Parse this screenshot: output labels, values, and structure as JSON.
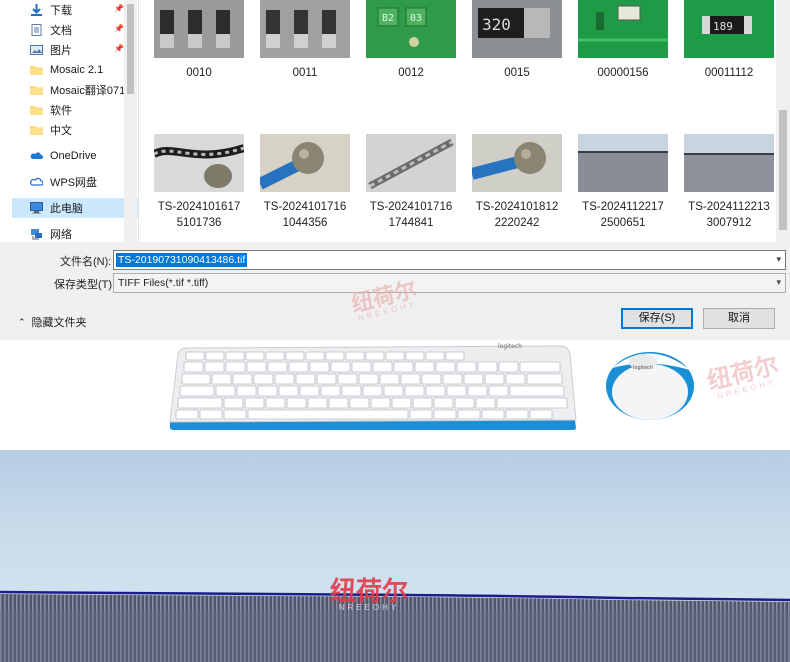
{
  "sidebar": {
    "items": [
      {
        "label": "下载",
        "icon": "download-arrow-icon",
        "pinned": true
      },
      {
        "label": "文档",
        "icon": "document-icon",
        "pinned": true
      },
      {
        "label": "图片",
        "icon": "pictures-icon",
        "pinned": true
      },
      {
        "label": "Mosaic 2.1",
        "icon": "folder-icon",
        "pinned": false
      },
      {
        "label": "Mosaic翻译071",
        "icon": "folder-icon",
        "pinned": false
      },
      {
        "label": "软件",
        "icon": "folder-icon",
        "pinned": false
      },
      {
        "label": "中文",
        "icon": "folder-icon",
        "pinned": false
      },
      {
        "label": "OneDrive",
        "icon": "onedrive-cloud-icon",
        "pinned": false
      },
      {
        "label": "WPS网盘",
        "icon": "wps-cloud-icon",
        "pinned": false
      },
      {
        "label": "此电脑",
        "icon": "this-pc-icon",
        "pinned": false,
        "selected": true
      },
      {
        "label": "网络",
        "icon": "network-icon",
        "pinned": false
      }
    ]
  },
  "files": {
    "row1": [
      {
        "name": "0010",
        "kind": "chip"
      },
      {
        "name": "0011",
        "kind": "chip"
      },
      {
        "name": "0012",
        "kind": "green-board"
      },
      {
        "name": "0015",
        "kind": "resistor-320"
      },
      {
        "name": "00000156",
        "kind": "green-board"
      },
      {
        "name": "00011112",
        "kind": "green-board-189"
      }
    ],
    "row2": [
      {
        "line1": "TS-20241016175",
        "line2": "101736",
        "name": "TS-2024101617",
        "name2": "5101736",
        "kind": "cable"
      },
      {
        "name": "TS-2024101716",
        "name2": "1044356",
        "kind": "ball-tip"
      },
      {
        "name": "TS-2024101716",
        "name2": "1744841",
        "kind": "drill"
      },
      {
        "name": "TS-2024101812",
        "name2": "2220242",
        "kind": "ball-tip"
      },
      {
        "name": "TS-2024112217",
        "name2": "2500651",
        "kind": "blade"
      },
      {
        "name": "TS-2024112213",
        "name2": "3007912",
        "kind": "blade"
      }
    ]
  },
  "thumb_text": {
    "b2": "B2",
    "t03": "03",
    "r320": "320",
    "r189": "189"
  },
  "form": {
    "filename_label": "文件名(N):",
    "filename_value": "TS-20190731090413486.tif",
    "filetype_label": "保存类型(T):",
    "filetype_value": "TIFF Files(*.tif *.tiff)",
    "hide_folders": "隐藏文件夹",
    "save_button": "保存(S)",
    "cancel_button": "取消"
  },
  "watermark": {
    "brand": "纽荷尔",
    "sub": "NREEOHY"
  },
  "keyboard": {
    "brand": "logitech",
    "mouse_brand": "logitech"
  },
  "colors": {
    "selection": "#0078d7",
    "nav_selected": "#cce8ff",
    "keyboard_trim": "#1a8fd6",
    "watermark": "#e8a7a7",
    "watermark_strong": "#e03b4a"
  }
}
